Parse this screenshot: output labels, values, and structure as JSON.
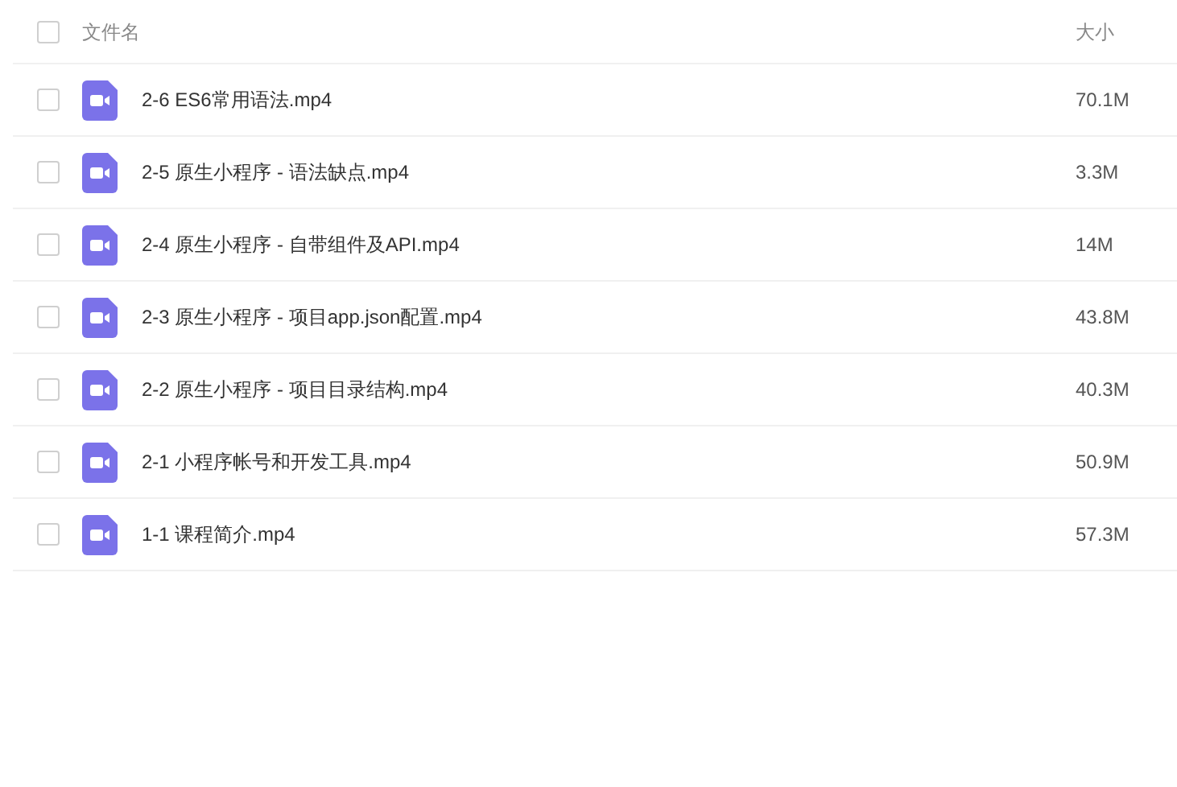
{
  "header": {
    "checked": false,
    "name_label": "文件名",
    "size_label": "大小"
  },
  "files": [
    {
      "name": "2-6 ES6常用语法.mp4",
      "size": "70.1M",
      "checked": false
    },
    {
      "name": "2-5 原生小程序 - 语法缺点.mp4",
      "size": "3.3M",
      "checked": false
    },
    {
      "name": "2-4 原生小程序 - 自带组件及API.mp4",
      "size": "14M",
      "checked": false
    },
    {
      "name": "2-3 原生小程序 - 项目app.json配置.mp4",
      "size": "43.8M",
      "checked": false
    },
    {
      "name": "2-2 原生小程序 - 项目目录结构.mp4",
      "size": "40.3M",
      "checked": false
    },
    {
      "name": "2-1 小程序帐号和开发工具.mp4",
      "size": "50.9M",
      "checked": false
    },
    {
      "name": "1-1 课程简介.mp4",
      "size": "57.3M",
      "checked": false
    }
  ]
}
